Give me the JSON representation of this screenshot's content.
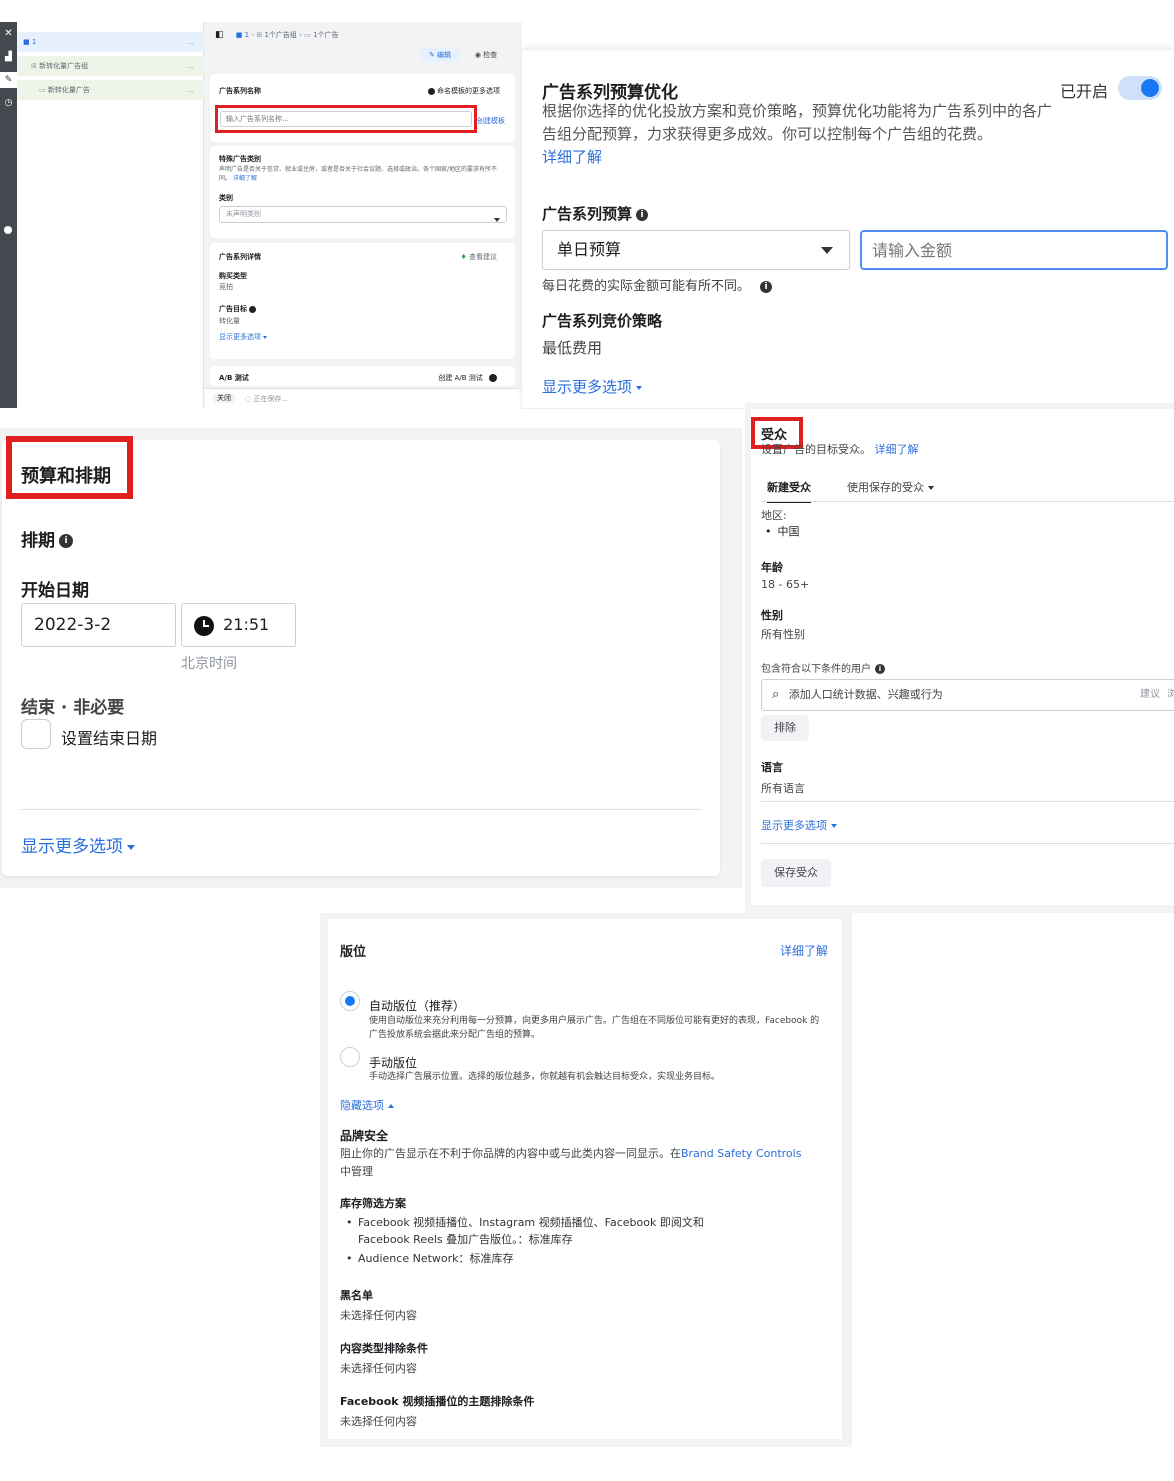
{
  "editor": {
    "tree": {
      "campaign_label": "1",
      "adset_label": "新转化量广告组",
      "ad_label": "新转化量广告",
      "more": "..."
    },
    "breadcrumb": {
      "campaign": "1",
      "adset": "1个广告组",
      "ad": "1个广告"
    },
    "edit_label": "编辑",
    "review_label": "检查",
    "name_section": {
      "title": "广告系列名称",
      "option": "命名模板的更多选项",
      "placeholder": "输入广告系列名称...",
      "create_template": "创建模板"
    },
    "special_category": {
      "title": "特殊广告类别",
      "desc": "声明广告是否关于信贷、就业或住房，或者是否关于社会议题、选择或政治。各个国家/地区的要求有所不同。",
      "learn_more": "详细了解",
      "category_label": "类别",
      "category_placeholder": "未声明类别"
    },
    "campaign_details": {
      "title": "广告系列详情",
      "view_suggestions": "查看建议",
      "buy_type_label": "购买类型",
      "buy_type_value": "竞拍",
      "objective_label": "广告目标",
      "objective_value": "转化量",
      "show_more": "显示更多选项"
    },
    "ab_test": {
      "title": "A/B 测试",
      "create": "创建 A/B 测试"
    },
    "footer": {
      "close": "关闭",
      "saving": "正在保存..."
    }
  },
  "budget_opt": {
    "title": "广告系列预算优化",
    "status": "已开启",
    "toggle_on": true,
    "desc": "根据你选择的优化投放方案和竞价策略，预算优化功能将为广告系列中的各广告组分配预算，力求获得更多成效。你可以控制每个广告组的花费。",
    "learn_more": "详细了解",
    "budget_label": "广告系列预算",
    "budget_type": "单日预算",
    "amount_placeholder": "请输入金额",
    "note": "每日花费的实际金额可能有所不同。",
    "bid_label": "广告系列竞价策略",
    "bid_value": "最低费用",
    "show_more": "显示更多选项"
  },
  "schedule": {
    "title": "预算和排期",
    "schedule_label": "排期",
    "start_label": "开始日期",
    "start_date": "2022-3-2",
    "start_time": "21:51",
    "timezone": "北京时间",
    "end_label": "结束 · 非必要",
    "end_checkbox": "设置结束日期",
    "show_more": "显示更多选项"
  },
  "audience": {
    "title": "受众",
    "desc_prefix": "设置广告的目标受众。",
    "learn_more": "详细了解",
    "tab_new": "新建受众",
    "tab_saved": "使用保存的受众",
    "location_label": "地区:",
    "location_value": "中国",
    "age_label": "年龄",
    "age_value": "18 - 65+",
    "gender_label": "性别",
    "gender_value": "所有性别",
    "include_label": "包含符合以下条件的用户",
    "search_placeholder": "添加人口统计数据、兴趣或行为",
    "suggest": "建议",
    "browse": "浏",
    "exclude": "排除",
    "language_label": "语言",
    "language_value": "所有语言",
    "show_more": "显示更多选项",
    "save": "保存受众"
  },
  "placement": {
    "title": "版位",
    "learn_more": "详细了解",
    "auto_title": "自动版位（推荐）",
    "auto_desc": "使用自动版位来充分利用每一分预算，向更多用户展示广告。广告组在不同版位可能有更好的表现，Facebook 的广告投放系统会据此来分配广告组的预算。",
    "manual_title": "手动版位",
    "manual_desc": "手动选择广告展示位置。选择的版位越多，你就越有机会触达目标受众，实现业务目标。",
    "hide_options": "隐藏选项",
    "brand_title": "品牌安全",
    "brand_desc_a": "阻止你的广告显示在不利于你品牌的内容中或与此类内容一同显示。在",
    "brand_link": "Brand Safety Controls",
    "brand_desc_b": "中管理",
    "inventory_title": "库存筛选方案",
    "inventory_items": [
      "Facebook 视频插播位、Instagram 视频插播位、Facebook 即阅文和 Facebook Reels 叠加广告版位。：标准库存",
      "Audience Network：标准库存"
    ],
    "blocklist_title": "黑名单",
    "blocklist_value": "未选择任何内容",
    "content_title": "内容类型排除条件",
    "content_value": "未选择任何内容",
    "topic_title": "Facebook 视频插播位的主题排除条件",
    "topic_value": "未选择任何内容"
  }
}
